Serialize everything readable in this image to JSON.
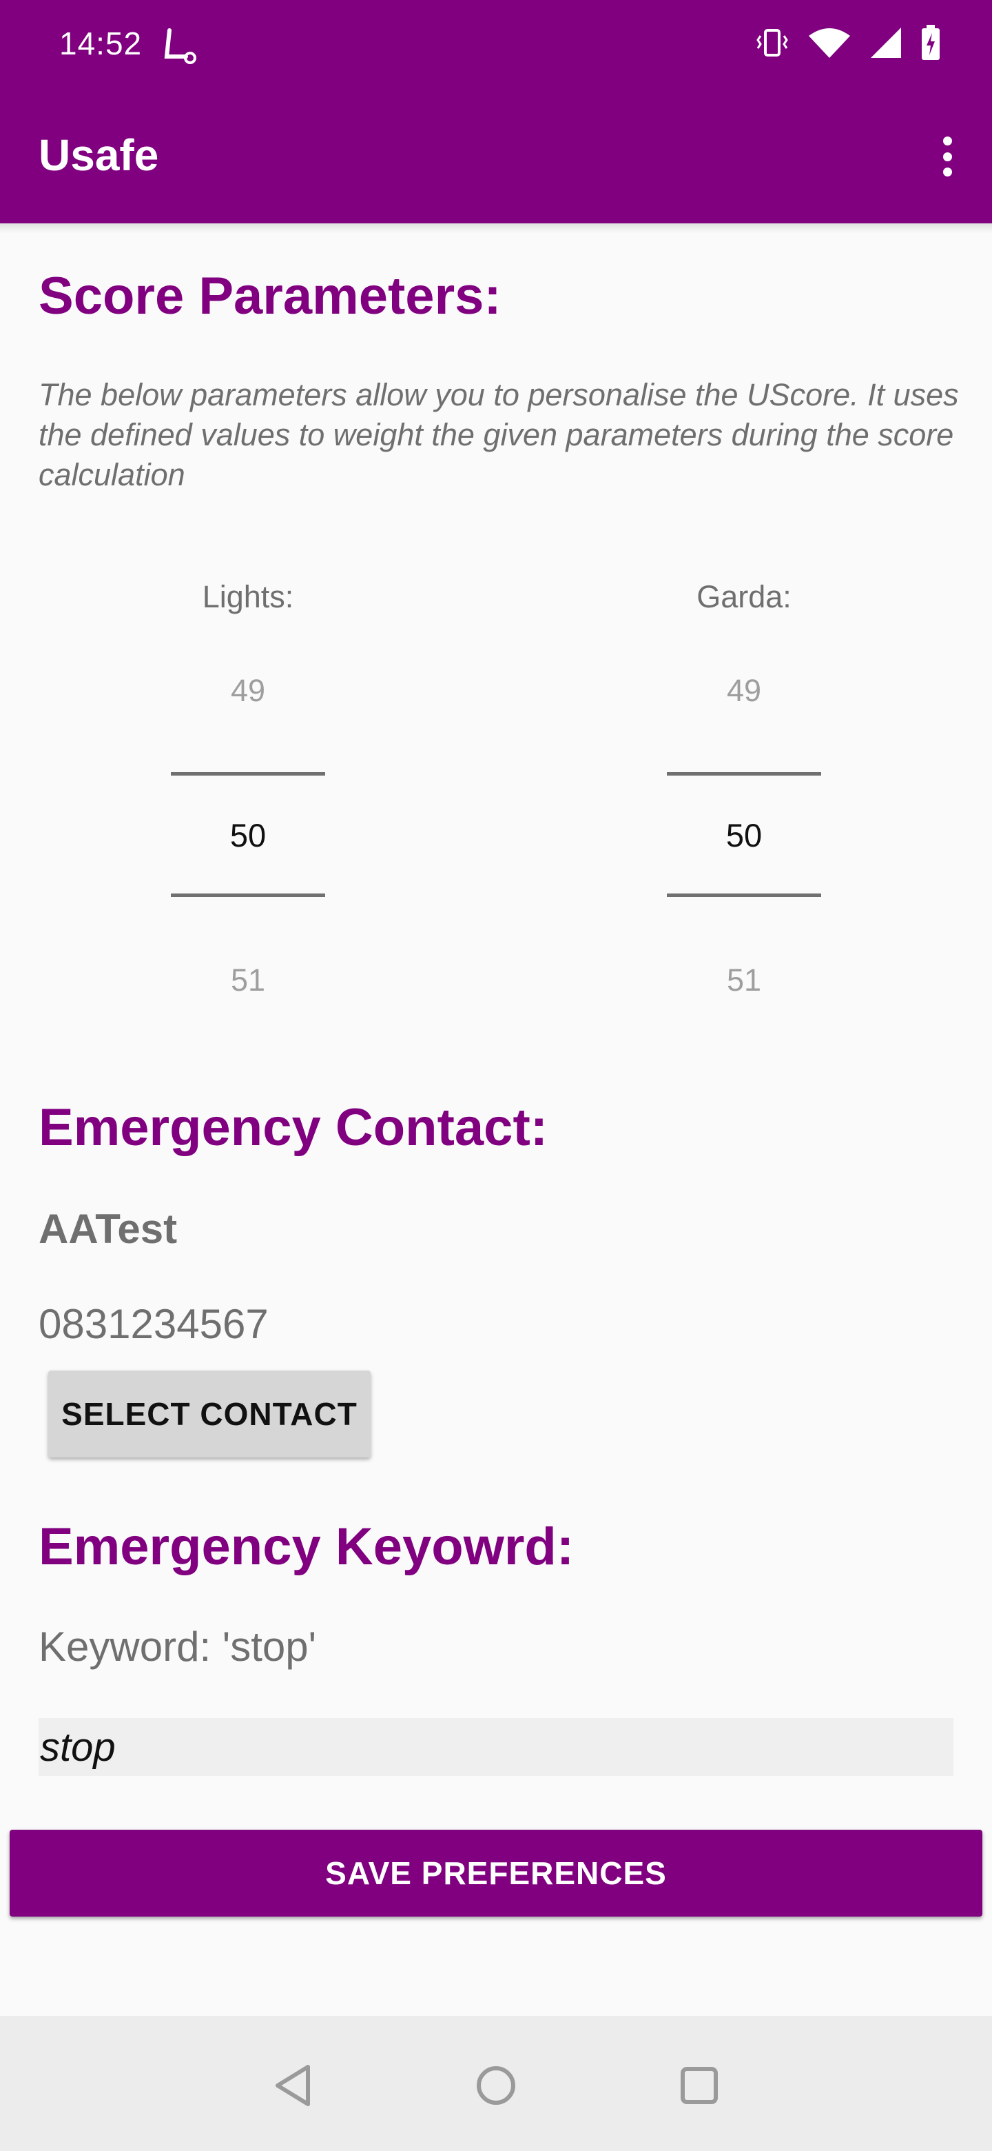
{
  "status_bar": {
    "time": "14:52",
    "icons": [
      "app-notification-icon",
      "vibrate-icon",
      "wifi-icon",
      "signal-icon",
      "battery-charging-icon"
    ]
  },
  "app_bar": {
    "title": "Usafe",
    "menu_icon": "more-vert-icon"
  },
  "score_parameters": {
    "heading": "Score Parameters:",
    "description": "The below parameters allow you to personalise the UScore. It uses the defined values to weight the given parameters during the score calculation",
    "pickers": [
      {
        "label": "Lights:",
        "prev": "49",
        "value": "50",
        "next": "51"
      },
      {
        "label": "Garda:",
        "prev": "49",
        "value": "50",
        "next": "51"
      }
    ]
  },
  "emergency_contact": {
    "heading": "Emergency Contact:",
    "name": "AATest",
    "number": "0831234567",
    "select_button": "SELECT CONTACT"
  },
  "emergency_keyword": {
    "heading": "Emergency Keyowrd:",
    "label": "Keyword: 'stop'",
    "input_value": "stop"
  },
  "save_button": "SAVE PREFERENCES",
  "nav_bar": {
    "icons": [
      "back-icon",
      "home-icon",
      "recents-icon"
    ]
  },
  "colors": {
    "primary": "#800080",
    "text_secondary": "#6f6f6f",
    "button_grey": "#d6d6d6"
  }
}
